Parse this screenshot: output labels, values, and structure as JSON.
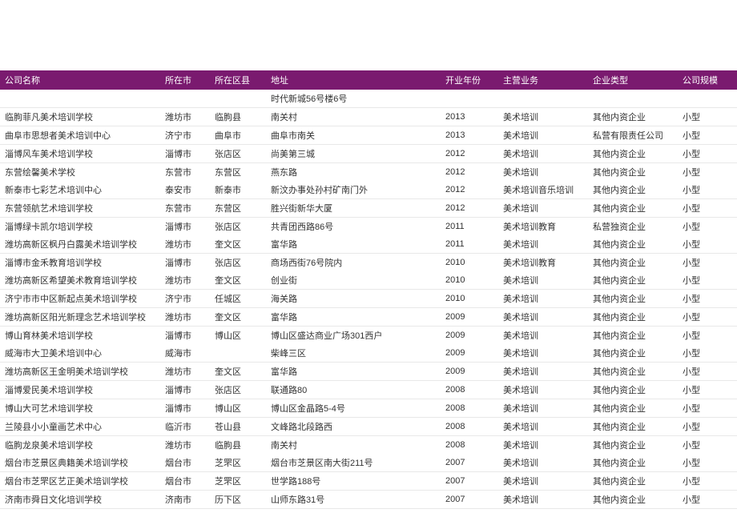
{
  "columns": {
    "name": "公司名称",
    "city": "所在市",
    "county": "所在区县",
    "addr": "地址",
    "year": "开业年份",
    "biz": "主营业务",
    "type": "企业类型",
    "scale": "公司规模"
  },
  "rows": [
    {
      "name": "",
      "city": "",
      "county": "",
      "addr": "时代新城56号楼6号",
      "year": "",
      "biz": "",
      "type": "",
      "scale": "",
      "nobd": false
    },
    {
      "name": "临朐菲凡美术培训学校",
      "city": "潍坊市",
      "county": "临朐县",
      "addr": "南关村",
      "year": "2013",
      "biz": "美术培训",
      "type": "其他内资企业",
      "scale": "小型",
      "nobd": false
    },
    {
      "name": "曲阜市思想者美术培训中心",
      "city": "济宁市",
      "county": "曲阜市",
      "addr": "曲阜市南关",
      "year": "2013",
      "biz": "美术培训",
      "type": "私营有限责任公司",
      "scale": "小型",
      "nobd": false
    },
    {
      "name": "淄博风车美术培训学校",
      "city": "淄博市",
      "county": "张店区",
      "addr": "尚美第三城",
      "year": "2012",
      "biz": "美术培训",
      "type": "其他内资企业",
      "scale": "小型",
      "nobd": false
    },
    {
      "name": "东营绘馨美术学校",
      "city": "东营市",
      "county": "东营区",
      "addr": "燕东路",
      "year": "2012",
      "biz": "美术培训",
      "type": "其他内资企业",
      "scale": "小型",
      "nobd": true
    },
    {
      "name": "新泰市七彩艺术培训中心",
      "city": "泰安市",
      "county": "新泰市",
      "addr": "新汶办事处孙村矿南门外",
      "year": "2012",
      "biz": "美术培训音乐培训",
      "type": "其他内资企业",
      "scale": "小型",
      "nobd": false
    },
    {
      "name": "东营领航艺术培训学校",
      "city": "东营市",
      "county": "东营区",
      "addr": "胜兴街新华大厦",
      "year": "2012",
      "biz": "美术培训",
      "type": "其他内资企业",
      "scale": "小型",
      "nobd": false
    },
    {
      "name": "淄博绿卡凯尔培训学校",
      "city": "淄博市",
      "county": "张店区",
      "addr": "共青团西路86号",
      "year": "2011",
      "biz": "美术培训教育",
      "type": "私营独资企业",
      "scale": "小型",
      "nobd": true
    },
    {
      "name": "潍坊高新区枫丹白露美术培训学校",
      "city": "潍坊市",
      "county": "奎文区",
      "addr": "富华路",
      "year": "2011",
      "biz": "美术培训",
      "type": "其他内资企业",
      "scale": "小型",
      "nobd": false
    },
    {
      "name": "淄博市金禾教育培训学校",
      "city": "淄博市",
      "county": "张店区",
      "addr": "商场西街76号院内",
      "year": "2010",
      "biz": "美术培训教育",
      "type": "其他内资企业",
      "scale": "小型",
      "nobd": true
    },
    {
      "name": "潍坊高新区希望美术教育培训学校",
      "city": "潍坊市",
      "county": "奎文区",
      "addr": "创业街",
      "year": "2010",
      "biz": "美术培训",
      "type": "其他内资企业",
      "scale": "小型",
      "nobd": false
    },
    {
      "name": "济宁市市中区新起点美术培训学校",
      "city": "济宁市",
      "county": "任城区",
      "addr": "海关路",
      "year": "2010",
      "biz": "美术培训",
      "type": "其他内资企业",
      "scale": "小型",
      "nobd": false
    },
    {
      "name": "潍坊高新区阳光新理念艺术培训学校",
      "city": "潍坊市",
      "county": "奎文区",
      "addr": "富华路",
      "year": "2009",
      "biz": "美术培训",
      "type": "其他内资企业",
      "scale": "小型",
      "nobd": false
    },
    {
      "name": "博山育林美术培训学校",
      "city": "淄博市",
      "county": "博山区",
      "addr": "博山区盛达商业广场301西户",
      "year": "2009",
      "biz": "美术培训",
      "type": "其他内资企业",
      "scale": "小型",
      "nobd": true
    },
    {
      "name": "威海市大卫美术培训中心",
      "city": "威海市",
      "county": "",
      "addr": "柴峰三区",
      "year": "2009",
      "biz": "美术培训",
      "type": "其他内资企业",
      "scale": "小型",
      "nobd": false
    },
    {
      "name": "潍坊高新区王金明美术培训学校",
      "city": "潍坊市",
      "county": "奎文区",
      "addr": "富华路",
      "year": "2009",
      "biz": "美术培训",
      "type": "其他内资企业",
      "scale": "小型",
      "nobd": false
    },
    {
      "name": "淄博爱民美术培训学校",
      "city": "淄博市",
      "county": "张店区",
      "addr": "联通路80",
      "year": "2008",
      "biz": "美术培训",
      "type": "其他内资企业",
      "scale": "小型",
      "nobd": false
    },
    {
      "name": "博山大可艺术培训学校",
      "city": "淄博市",
      "county": "博山区",
      "addr": "博山区金晶路5-4号",
      "year": "2008",
      "biz": "美术培训",
      "type": "其他内资企业",
      "scale": "小型",
      "nobd": false
    },
    {
      "name": "兰陵县小小童画艺术中心",
      "city": "临沂市",
      "county": "苍山县",
      "addr": "文峰路北段路西",
      "year": "2008",
      "biz": "美术培训",
      "type": "其他内资企业",
      "scale": "小型",
      "nobd": false
    },
    {
      "name": "临朐龙泉美术培训学校",
      "city": "潍坊市",
      "county": "临朐县",
      "addr": "南关村",
      "year": "2008",
      "biz": "美术培训",
      "type": "其他内资企业",
      "scale": "小型",
      "nobd": true
    },
    {
      "name": "烟台市芝景区典籍美术培训学校",
      "city": "烟台市",
      "county": "芝罘区",
      "addr": "烟台市芝景区南大街211号",
      "year": "2007",
      "biz": "美术培训",
      "type": "其他内资企业",
      "scale": "小型",
      "nobd": false
    },
    {
      "name": "烟台市芝罘区艺正美术培训学校",
      "city": "烟台市",
      "county": "芝罘区",
      "addr": "世学路188号",
      "year": "2007",
      "biz": "美术培训",
      "type": "其他内资企业",
      "scale": "小型",
      "nobd": false
    },
    {
      "name": "济南市舜日文化培训学校",
      "city": "济南市",
      "county": "历下区",
      "addr": "山师东路31号",
      "year": "2007",
      "biz": "美术培训",
      "type": "其他内资企业",
      "scale": "小型",
      "nobd": false
    }
  ]
}
